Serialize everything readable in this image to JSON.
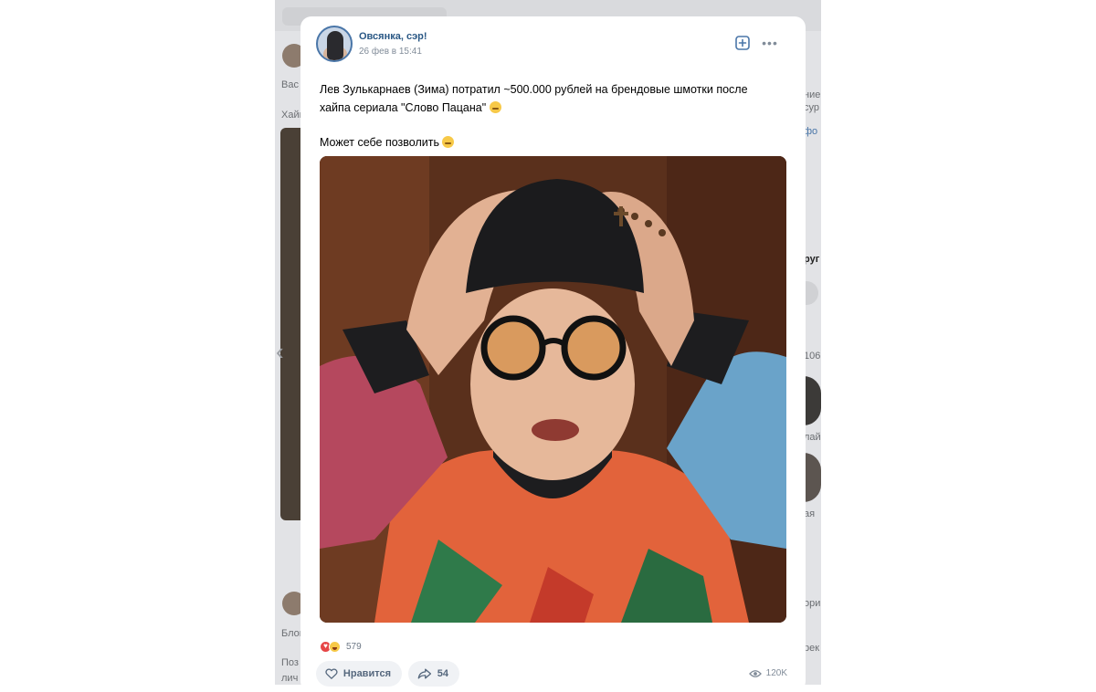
{
  "post": {
    "author_name": "Овсянка, сэр!",
    "date": "26 фев в 15:41",
    "text_paragraph_1": "Лев Зулькарнаев (Зима) потратил ~500.000 рублей на брендовые шмотки после хайпа сериала \"Слово Пацана\"",
    "text_paragraph_2": "Может себе позволить",
    "reactions_count": "579",
    "like_label": "Нравится",
    "share_count": "54",
    "views_count": "120K"
  },
  "background": {
    "snippets": [
      "Вас",
      "Хайп",
      "Блог",
      "Поз",
      "лич",
      "ние",
      "сур",
      "фо",
      "руг",
      "106",
      "лай",
      "ая",
      "ори",
      "рек"
    ]
  },
  "icons": {
    "subscribe": "plus-square-icon",
    "more": "more-dots-icon",
    "like": "heart-icon",
    "share": "share-arrow-icon",
    "views": "eye-icon",
    "reaction_heart": "heart-reaction-icon",
    "reaction_laugh": "laugh-reaction-icon",
    "nav_prev": "chevron-left-icon"
  },
  "colors": {
    "accent": "#2a5885",
    "muted": "#818c99",
    "pill_bg": "#f0f2f5"
  }
}
